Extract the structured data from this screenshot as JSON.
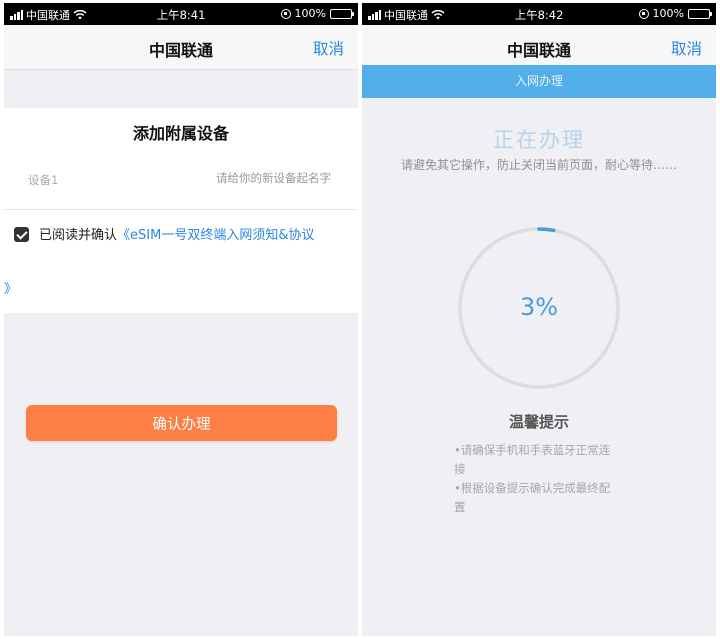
{
  "left": {
    "status": {
      "carrier": "中国联通",
      "time": "上午8:41",
      "battery": "100%"
    },
    "nav": {
      "title": "中国联通",
      "cancel": "取消"
    },
    "card": {
      "title": "添加附属设备",
      "device_label": "设备1",
      "device_placeholder": "请给你的新设备起名字",
      "device_value": "",
      "agree_prefix": "已阅读并确认",
      "agree_link": "《eSIM一号双终端入网须知&协议",
      "agree_link_tail": "》",
      "agree_checked": true
    },
    "confirm_button": "确认办理",
    "colors": {
      "accent": "#fd7f44",
      "link": "#2a86e0"
    }
  },
  "right": {
    "status": {
      "carrier": "中国联通",
      "time": "上午8:42",
      "battery": "100%"
    },
    "nav": {
      "title": "中国联通",
      "cancel": "取消"
    },
    "banner": "入网办理",
    "processing_title": "正在办理",
    "processing_subtitle": "请避免其它操作，防止关闭当前页面，耐心等待……",
    "progress": 3,
    "progress_text": "3%",
    "tips_title": "温馨提示",
    "tips": [
      "•请确保手机和手表蓝牙正常连接",
      "•根据设备提示确认完成最终配置"
    ],
    "colors": {
      "banner": "#51aee8",
      "progress": "#4d9ad8"
    }
  }
}
